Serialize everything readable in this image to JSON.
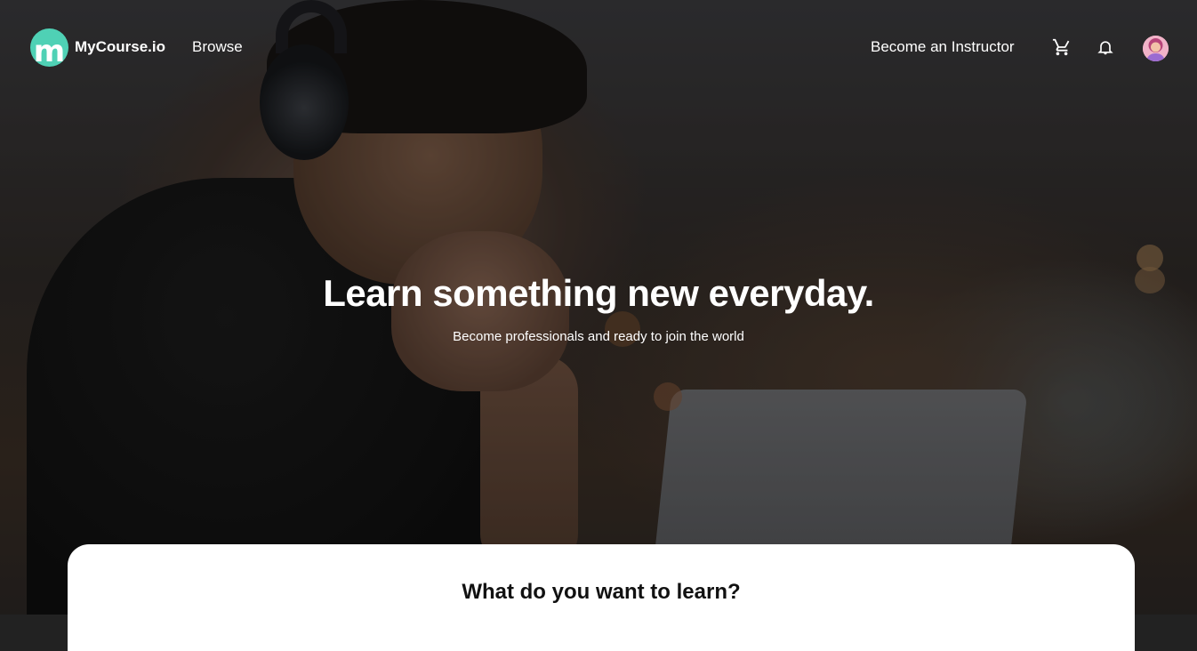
{
  "header": {
    "logo_letter": "m",
    "brand": "MyCourse.io",
    "browse_label": "Browse",
    "instructor_label": "Become an Instructor",
    "cart_icon": "cart-icon",
    "bell_icon": "bell-icon"
  },
  "hero": {
    "title": "Learn something new everyday.",
    "subtitle": "Become professionals and ready to join the world"
  },
  "search_card": {
    "title": "What do you want to learn?"
  },
  "colors": {
    "brand_accent": "#4fd1b5",
    "card_bg": "#ffffff",
    "text_light": "#ffffff"
  }
}
